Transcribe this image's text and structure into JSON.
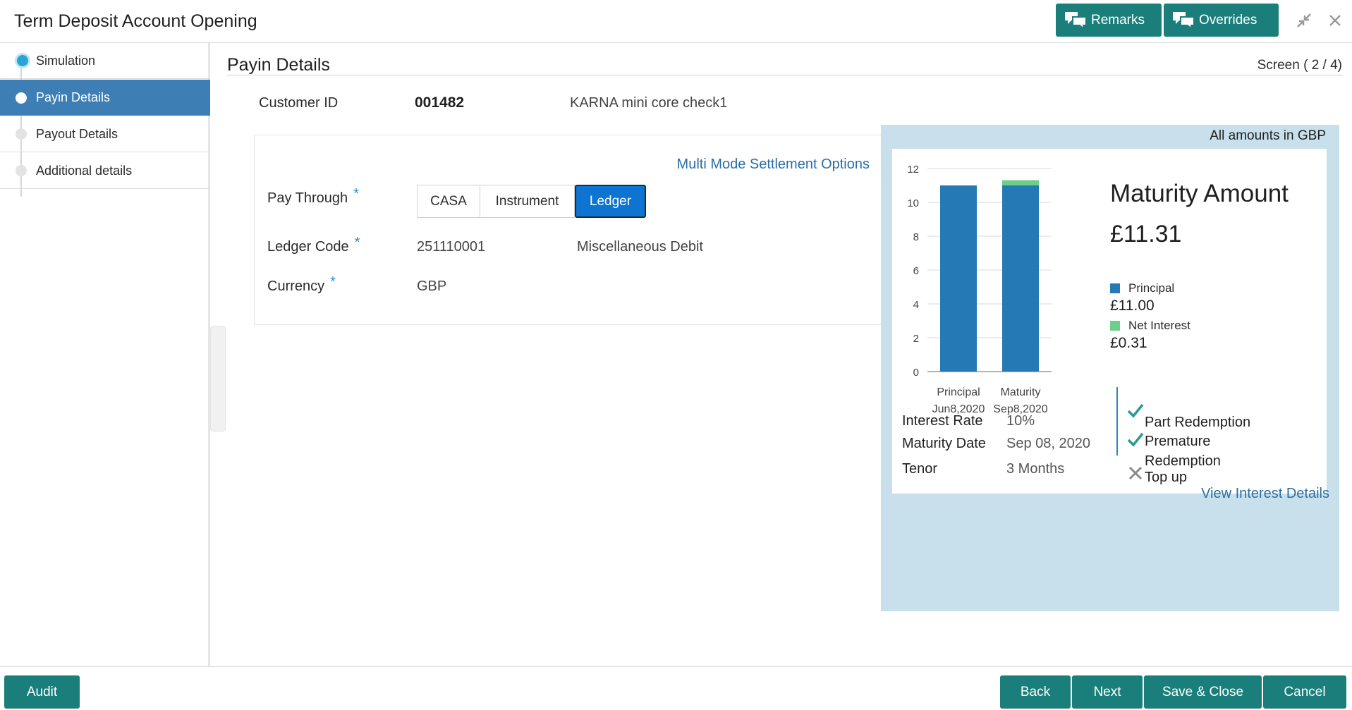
{
  "header": {
    "title": "Term Deposit Account Opening",
    "remarks_label": "Remarks",
    "overrides_label": "Overrides",
    "accent": "#1a7f7a"
  },
  "sidebar": {
    "items": [
      {
        "label": "Simulation",
        "state": "current"
      },
      {
        "label": "Payin Details",
        "state": "active"
      },
      {
        "label": "Payout Details",
        "state": "pending"
      },
      {
        "label": "Additional details",
        "state": "pending"
      }
    ]
  },
  "main": {
    "title": "Payin Details",
    "screen_indicator": "Screen ( 2 / 4)",
    "customer": {
      "label": "Customer ID",
      "id": "001482",
      "name": "KARNA mini core check1"
    },
    "multi_mode_link": "Multi Mode Settlement Options",
    "pay_through": {
      "label": "Pay Through",
      "options": [
        "CASA",
        "Instrument",
        "Ledger"
      ],
      "selected": "Ledger"
    },
    "ledger_code": {
      "label": "Ledger Code",
      "value": "251110001",
      "description": "Miscellaneous Debit"
    },
    "currency": {
      "label": "Currency",
      "value": "GBP"
    },
    "required_marker": "*"
  },
  "summary": {
    "amounts_note": "All amounts in GBP",
    "maturity_title": "Maturity Amount",
    "maturity_amount": "£11.31",
    "legend": [
      {
        "name": "Principal",
        "value": "£11.00",
        "color": "#2579b4"
      },
      {
        "name": "Net Interest",
        "value": "£0.31",
        "color": "#6dcf8a"
      }
    ],
    "interest_rate_label": "Interest Rate",
    "interest_rate": "10%",
    "maturity_date_label": "Maturity Date",
    "maturity_date": "Sep 08, 2020",
    "tenor_label": "Tenor",
    "tenor": "3 Months",
    "features": [
      {
        "label": "Part Redemption",
        "enabled": true
      },
      {
        "label": "Premature Redemption",
        "enabled": true
      },
      {
        "label": "Top up",
        "enabled": false
      }
    ],
    "view_interest_link": "View Interest Details"
  },
  "chart_data": {
    "type": "bar",
    "stacked": true,
    "categories": [
      "Principal Jun8,2020",
      "Maturity Sep8,2020"
    ],
    "category_lines": [
      [
        "Principal",
        "Jun8,2020"
      ],
      [
        "Maturity",
        "Sep8,2020"
      ]
    ],
    "series": [
      {
        "name": "Principal",
        "values": [
          11.0,
          11.0
        ],
        "color": "#2579b4"
      },
      {
        "name": "Net Interest",
        "values": [
          0,
          0.31
        ],
        "color": "#6dcf8a"
      }
    ],
    "y_ticks": [
      0,
      2,
      4,
      6,
      8,
      10,
      12
    ],
    "ylim": [
      0,
      12
    ],
    "grid": true,
    "legend": "right"
  },
  "footer": {
    "audit_label": "Audit",
    "back_label": "Back",
    "next_label": "Next",
    "save_close_label": "Save & Close",
    "cancel_label": "Cancel"
  }
}
